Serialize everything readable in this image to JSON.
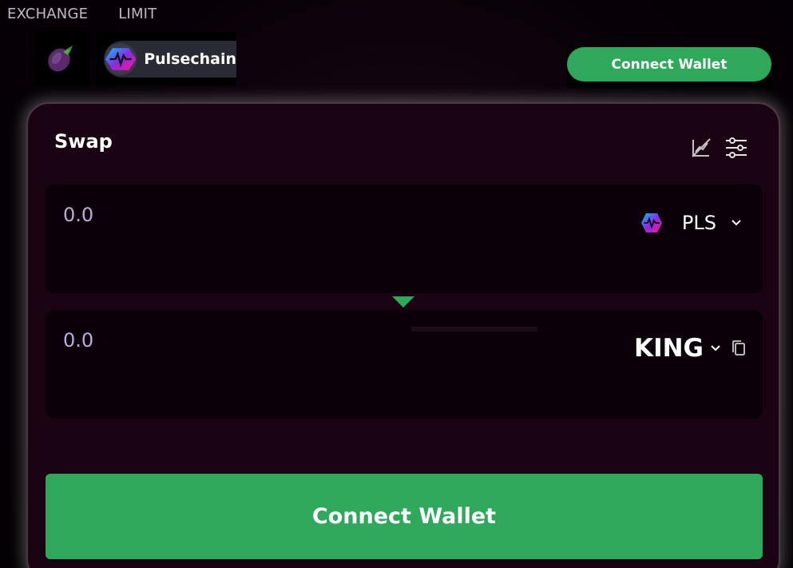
{
  "nav": {
    "exchange": "EXCHANGE",
    "limit": "LIMIT"
  },
  "network": {
    "label": "Pulsechain"
  },
  "header": {
    "connect_label": "Connect Wallet"
  },
  "swap": {
    "title": "Swap",
    "from": {
      "amount": "0.0",
      "token": "PLS"
    },
    "to": {
      "amount": "0.0",
      "token": "KING"
    },
    "connect_label": "Connect Wallet"
  },
  "colors": {
    "accent": "#2fa85c",
    "card": "#1a0413",
    "box": "#0b0009",
    "amount_text": "#b7aedc"
  },
  "icons": [
    "eggplant-logo-icon",
    "pulsechain-icon",
    "chart-toggle-icon",
    "settings-sliders-icon",
    "chevron-down-icon",
    "copy-icon",
    "switch-arrow-icon"
  ]
}
